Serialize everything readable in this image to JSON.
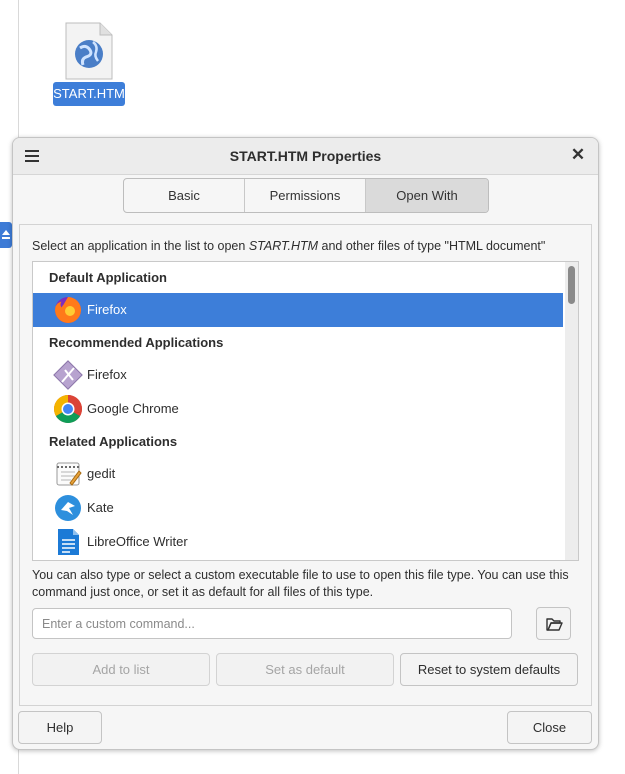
{
  "desktop": {
    "file_label": "START.HTM"
  },
  "dialog": {
    "title": "START.HTM Properties",
    "tabs": [
      {
        "label": "Basic",
        "active": false
      },
      {
        "label": "Permissions",
        "active": false
      },
      {
        "label": "Open With",
        "active": true
      }
    ],
    "instruction_prefix": "Select an application in the list to open ",
    "instruction_file": "START.HTM",
    "instruction_suffix": " and other files of type \"HTML document\"",
    "sections": {
      "default": "Default Application",
      "recommended": "Recommended Applications",
      "related": "Related Applications"
    },
    "apps": {
      "default": [
        {
          "label": "Firefox",
          "icon": "firefox-icon",
          "selected": true
        }
      ],
      "recommended": [
        {
          "label": "Firefox",
          "icon": "firefox-generic-icon"
        },
        {
          "label": "Google Chrome",
          "icon": "chrome-icon"
        }
      ],
      "related": [
        {
          "label": "gedit",
          "icon": "gedit-icon"
        },
        {
          "label": "Kate",
          "icon": "kate-icon"
        },
        {
          "label": "LibreOffice Writer",
          "icon": "libreoffice-writer-icon"
        }
      ]
    },
    "help_text": "You can also type or select a custom executable file to use to open this file type.  You can use this command just once, or set it as default for all files of this type.",
    "custom_command_placeholder": "Enter a custom command...",
    "buttons": {
      "add_to_list": "Add to list",
      "set_as_default": "Set as default",
      "reset": "Reset to system defaults",
      "help": "Help",
      "close": "Close"
    },
    "colors": {
      "selection": "#3d7ed9",
      "tab_active": "#dadada"
    }
  }
}
